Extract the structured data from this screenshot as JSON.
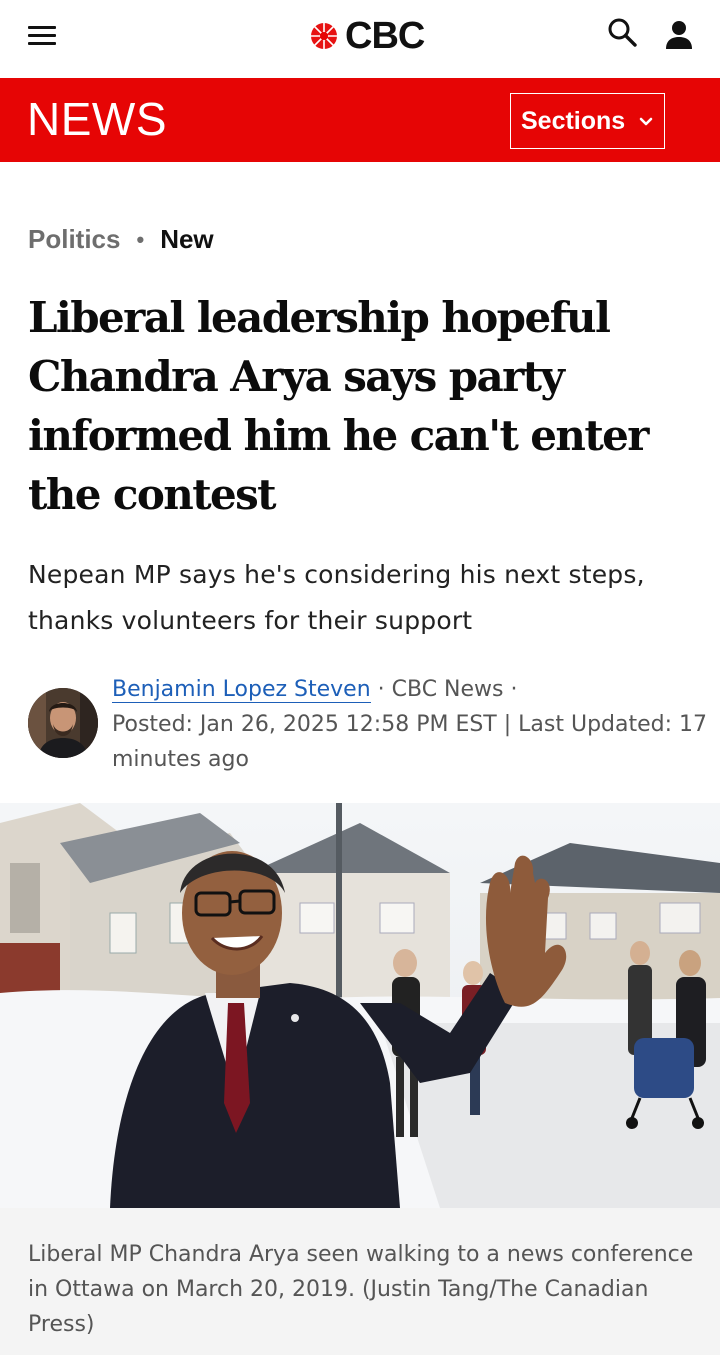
{
  "header": {
    "logo_text": "CBC",
    "menu_icon": "hamburger-menu-icon",
    "search_icon": "search-icon",
    "account_icon": "account-icon",
    "brand_color": "#e60505"
  },
  "newsbar": {
    "title": "NEWS",
    "sections_label": "Sections"
  },
  "article": {
    "category": "Politics",
    "flag": "New",
    "headline": "Liberal leadership hopeful Chandra Arya says party informed him he can't enter the contest",
    "deck": "Nepean MP says he's considering his next steps, thanks volunteers for their support",
    "author": "Benjamin Lopez Steven",
    "outlet": " · CBC News ·",
    "posted": "Posted: Jan 26, 2025 12:58 PM EST | Last Updated: 17 minutes ago",
    "caption": "Liberal MP Chandra Arya seen walking to a news conference in Ottawa on March 20, 2019. (Justin Tang/The Canadian Press)"
  }
}
